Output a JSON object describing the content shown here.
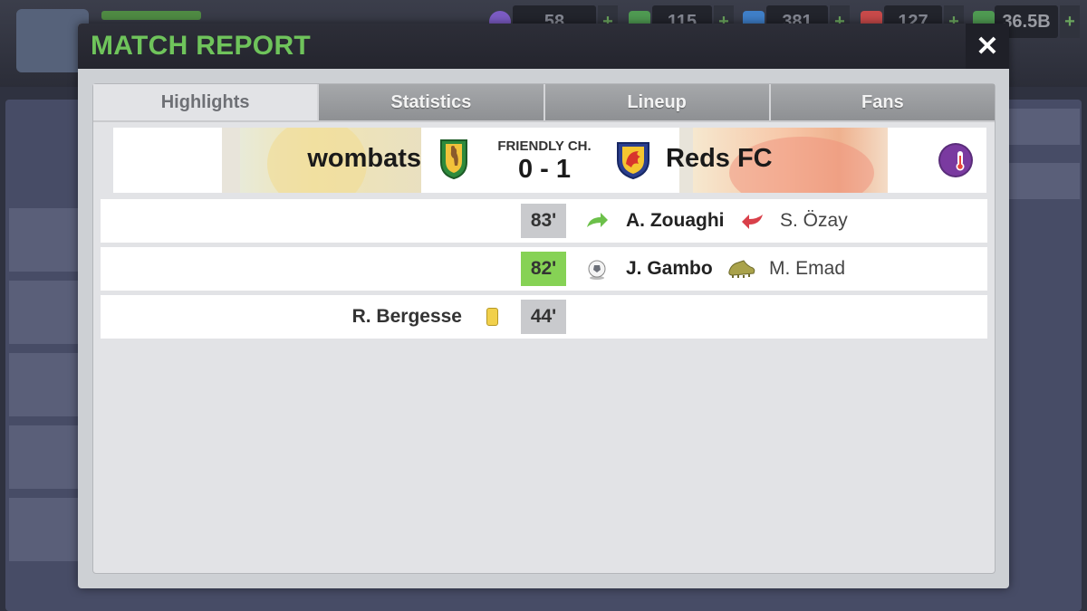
{
  "top_bar": {
    "resources": [
      {
        "icon": "coin-icon",
        "value": "58"
      },
      {
        "icon": "ticket-icon",
        "value": "115"
      },
      {
        "icon": "lightning-icon",
        "value": "381"
      },
      {
        "icon": "medical-icon",
        "value": "127"
      },
      {
        "icon": "cash-icon",
        "value": "36.5B"
      }
    ],
    "plus_label": "+"
  },
  "modal": {
    "title": "MATCH REPORT",
    "close_label": "✕"
  },
  "tabs": [
    {
      "label": "Highlights",
      "active": true
    },
    {
      "label": "Statistics",
      "active": false
    },
    {
      "label": "Lineup",
      "active": false
    },
    {
      "label": "Fans",
      "active": false
    }
  ],
  "match": {
    "home_team": "wombats",
    "away_team": "Reds FC",
    "competition": "FRIENDLY CH.",
    "score": "0 - 1",
    "home_badge_icon": "kangaroo-shield-icon",
    "away_badge_icon": "dragon-shield-icon",
    "weather_icon": "night-temperature-icon"
  },
  "events": [
    {
      "minute": "83'",
      "type": "substitution",
      "highlight": false,
      "in_icon": "sub-in-arrow-icon",
      "out_icon": "sub-out-arrow-icon",
      "player_main": "A. Zouaghi",
      "player_secondary": "S. Özay"
    },
    {
      "minute": "82'",
      "type": "goal",
      "highlight": true,
      "goal_icon": "ball-icon",
      "assist_icon": "boot-icon",
      "player_main": "J. Gambo",
      "player_secondary": "M. Emad"
    },
    {
      "minute": "44'",
      "type": "yellow-card",
      "highlight": false,
      "card_icon": "yellow-card-icon",
      "player_left": "R. Bergesse"
    }
  ],
  "colors": {
    "title_green": "#6fc45b",
    "goal_green": "#86d255",
    "yellow_card": "#f1d04b"
  }
}
